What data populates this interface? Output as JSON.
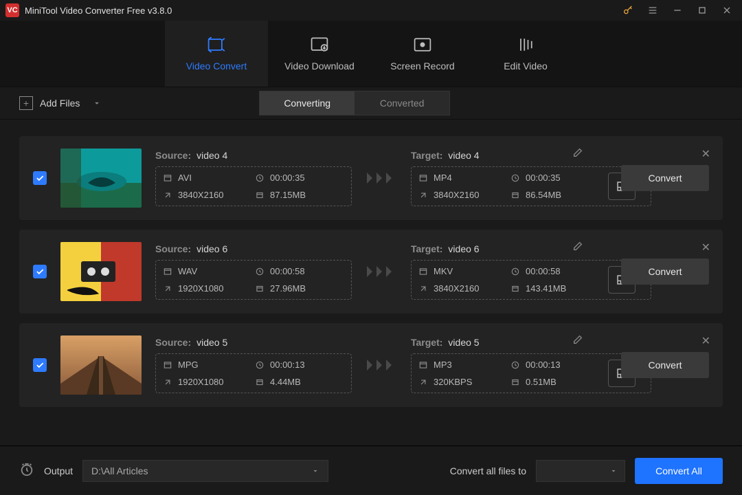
{
  "app": {
    "logo_text": "VC",
    "title": "MiniTool Video Converter Free v3.8.0"
  },
  "nav": {
    "items": [
      {
        "label": "Video Convert",
        "active": true
      },
      {
        "label": "Video Download",
        "active": false
      },
      {
        "label": "Screen Record",
        "active": false
      },
      {
        "label": "Edit Video",
        "active": false
      }
    ]
  },
  "toolbar": {
    "add_files_label": "Add Files",
    "tabs": {
      "converting": "Converting",
      "converted": "Converted",
      "active": "converting"
    }
  },
  "rows": [
    {
      "checked": true,
      "source": {
        "title_label": "Source:",
        "name": "video 4",
        "format": "AVI",
        "duration": "00:00:35",
        "resolution": "3840X2160",
        "size": "87.15MB"
      },
      "target": {
        "title_label": "Target:",
        "name": "video 4",
        "format": "MP4",
        "duration": "00:00:35",
        "resolution": "3840X2160",
        "size": "86.54MB"
      },
      "convert_label": "Convert",
      "thumb": "coast"
    },
    {
      "checked": true,
      "source": {
        "title_label": "Source:",
        "name": "video 6",
        "format": "WAV",
        "duration": "00:00:58",
        "resolution": "1920X1080",
        "size": "27.96MB"
      },
      "target": {
        "title_label": "Target:",
        "name": "video 6",
        "format": "MKV",
        "duration": "00:00:58",
        "resolution": "3840X2160",
        "size": "143.41MB"
      },
      "convert_label": "Convert",
      "thumb": "cassette"
    },
    {
      "checked": true,
      "source": {
        "title_label": "Source:",
        "name": "video 5",
        "format": "MPG",
        "duration": "00:00:13",
        "resolution": "1920X1080",
        "size": "4.44MB"
      },
      "target": {
        "title_label": "Target:",
        "name": "video 5",
        "format": "MP3",
        "duration": "00:00:13",
        "resolution": "320KBPS",
        "size": "0.51MB"
      },
      "convert_label": "Convert",
      "thumb": "pier"
    }
  ],
  "footer": {
    "output_label": "Output",
    "output_path": "D:\\All Articles",
    "convert_all_to_label": "Convert all files to",
    "convert_all_btn": "Convert All"
  }
}
